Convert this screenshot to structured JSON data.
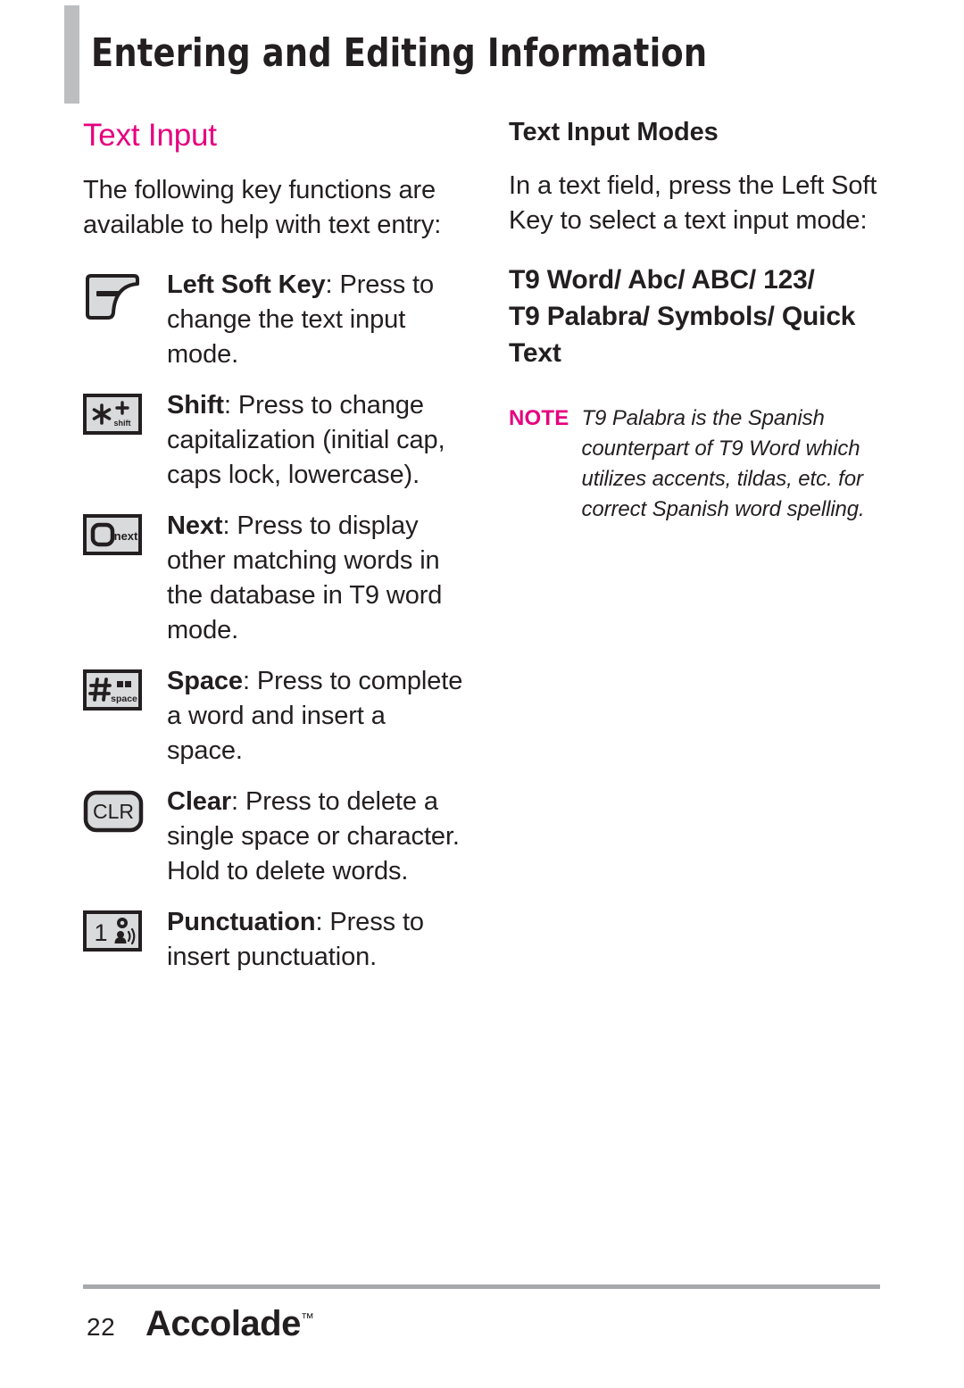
{
  "header": {
    "title": "Entering and Editing Information",
    "accent_bar_color": "#bcbec0"
  },
  "colors": {
    "accent_pink": "#e6007e",
    "text": "#231f20",
    "rule_gray": "#a7a9ac"
  },
  "left_column": {
    "heading": "Text Input",
    "intro": "The following key functions are available to help with text entry:",
    "keys": [
      {
        "icon": "left-soft-key-icon",
        "label": "Left Soft Key",
        "description": ": Press to change the text input mode."
      },
      {
        "icon": "shift-star-key-icon",
        "icon_glyphs": {
          "star": "✱",
          "plus": "+",
          "caption": "shift"
        },
        "label": "Shift",
        "description": ": Press to change capitalization (initial cap, caps lock, lowercase)."
      },
      {
        "icon": "next-key-icon",
        "icon_glyphs": {
          "caption": "next"
        },
        "label": "Next",
        "description": ": Press to display other matching words in the database in T9 word mode."
      },
      {
        "icon": "space-hash-key-icon",
        "icon_glyphs": {
          "hash": "#",
          "caption": "space"
        },
        "label": "Space",
        "description": ": Press to complete a word and insert a space."
      },
      {
        "icon": "clear-key-icon",
        "icon_glyphs": {
          "caption": "CLR"
        },
        "label": "Clear",
        "description": ": Press to delete a single space or character. Hold to delete words."
      },
      {
        "icon": "punctuation-one-key-icon",
        "icon_glyphs": {
          "digit": "1"
        },
        "label": "Punctuation",
        "description": ": Press to insert punctuation."
      }
    ]
  },
  "right_column": {
    "heading": "Text Input Modes",
    "intro": "In a text field, press the Left Soft Key to select a text input mode:",
    "modes_line_1": "T9 Word/ Abc/ ABC/ 123/",
    "modes_line_2": "T9 Palabra/ Symbols/ Quick Text",
    "note": {
      "label": "NOTE",
      "text": "T9 Palabra is the Spanish counterpart of T9 Word which utilizes accents, tildas, etc. for correct Spanish word spelling."
    }
  },
  "footer": {
    "page_number": "22",
    "brand": "Accolade",
    "trademark": "™"
  }
}
